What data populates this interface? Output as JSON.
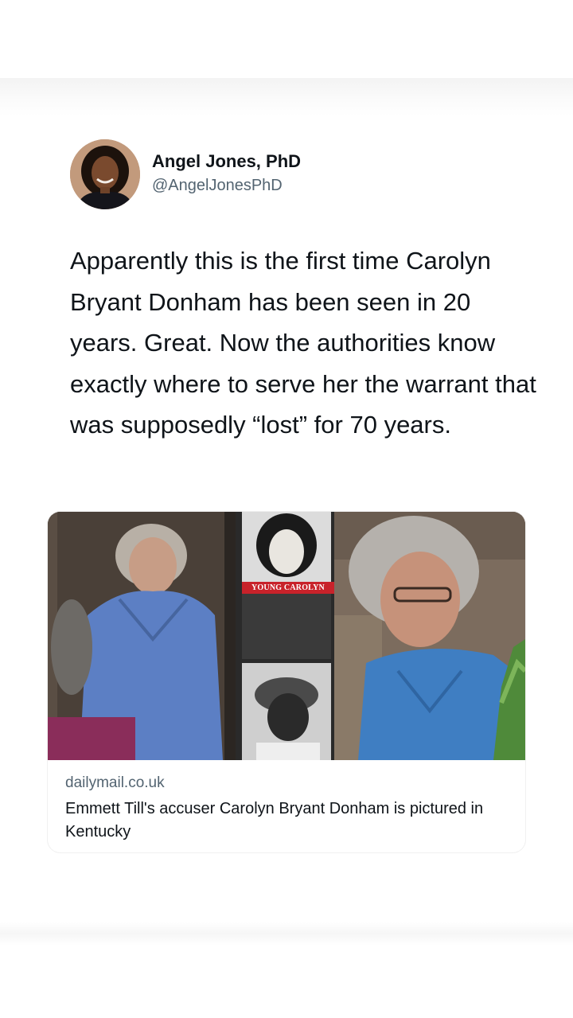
{
  "author": {
    "display_name": "Angel Jones, PhD",
    "handle": "@AngelJonesPhD"
  },
  "tweet_text": "Apparently this is the first time Carolyn Bryant Donham has been seen in 20 years. Great. Now the authorities know exactly where to serve her the warrant that was supposedly “lost” for 70 years.",
  "link_card": {
    "image_caption_label": "YOUNG CAROLYN",
    "domain": "dailymail.co.uk",
    "title": "Emmett Till's accuser Carolyn Bryant Donham is pictured in Kentucky"
  }
}
